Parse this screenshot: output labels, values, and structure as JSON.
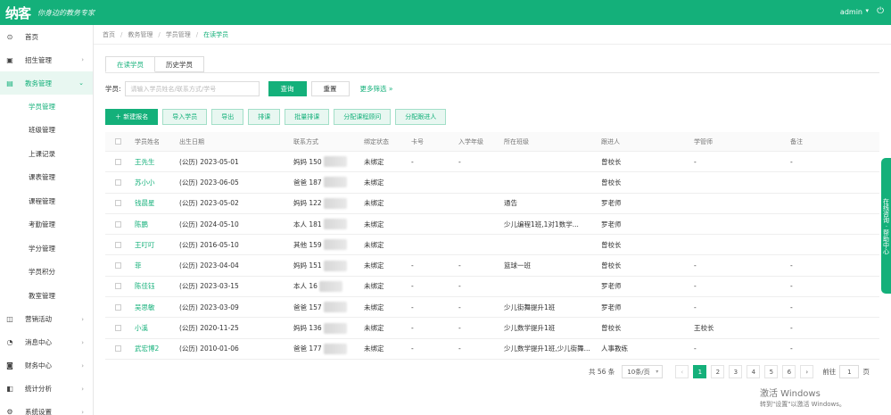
{
  "header": {
    "logo": "纳客",
    "slogan": "你身边的教务专家",
    "user": "admin"
  },
  "sidebar": {
    "items": [
      {
        "icon": "home-icon",
        "label": "首页",
        "arrow": ""
      },
      {
        "icon": "recruit-icon",
        "label": "招生管理",
        "arrow": "›"
      },
      {
        "icon": "book-icon",
        "label": "教务管理",
        "arrow": "⌄"
      }
    ],
    "sub_items": [
      "学员管理",
      "班级管理",
      "上课记录",
      "课表管理",
      "课程管理",
      "考勤管理",
      "学分管理",
      "学员积分",
      "教室管理"
    ],
    "bottom_items": [
      {
        "icon": "marketing-icon",
        "label": "营销活动",
        "arrow": "›"
      },
      {
        "icon": "message-icon",
        "label": "消息中心",
        "arrow": "›"
      },
      {
        "icon": "finance-icon",
        "label": "财务中心",
        "arrow": "›"
      },
      {
        "icon": "stats-icon",
        "label": "统计分析",
        "arrow": "›"
      },
      {
        "icon": "settings-icon",
        "label": "系统设置",
        "arrow": "›"
      }
    ]
  },
  "breadcrumb": {
    "home": "首页",
    "l1": "教务管理",
    "l2": "学员管理",
    "current": "在读学员"
  },
  "tabs": [
    "在读学员",
    "历史学员"
  ],
  "search": {
    "label": "学员:",
    "placeholder": "请输入学员姓名/联系方式/学号",
    "query_btn": "查询",
    "reset_btn": "重置",
    "more": "更多筛选 »"
  },
  "actions": [
    "＋ 新建报名",
    "导入学员",
    "导出",
    "排课",
    "批量排课",
    "分配课程顾问",
    "分配跟进人"
  ],
  "table": {
    "headers": [
      "学员姓名",
      "出生日期",
      "联系方式",
      "绑定状态",
      "卡号",
      "入学年级",
      "所在班级",
      "跟进人",
      "学管师",
      "备注"
    ],
    "rows": [
      [
        "王先生",
        "(公历) 2023-05-01",
        "妈妈 150",
        "未绑定",
        "-",
        "-",
        "",
        "曾校长",
        "-",
        "-"
      ],
      [
        "苏小小",
        "(公历) 2023-06-05",
        "爸爸 187",
        "未绑定",
        "",
        "",
        "",
        "曾校长",
        "",
        ""
      ],
      [
        "钱晨星",
        "(公历) 2023-05-02",
        "妈妈 122",
        "未绑定",
        "",
        "",
        "通告",
        "罗老师",
        "",
        ""
      ],
      [
        "陈鹏",
        "(公历) 2024-05-10",
        "本人 181",
        "未绑定",
        "",
        "",
        "少儿编程1班,1对1数学...",
        "罗老师",
        "",
        ""
      ],
      [
        "王叮叮",
        "(公历) 2016-05-10",
        "其他 159",
        "未绑定",
        "",
        "",
        "",
        "曾校长",
        "",
        ""
      ],
      [
        "菲",
        "(公历) 2023-04-04",
        "妈妈 151",
        "未绑定",
        "-",
        "-",
        "篮球一班",
        "曾校长",
        "-",
        "-"
      ],
      [
        "陈佳钰",
        "(公历) 2023-03-15",
        "本人 16",
        "未绑定",
        "-",
        "-",
        "",
        "罗老师",
        "-",
        "-"
      ],
      [
        "吴思敏",
        "(公历) 2023-03-09",
        "爸爸 157",
        "未绑定",
        "-",
        "-",
        "少儿街舞提升1班",
        "罗老师",
        "-",
        "-"
      ],
      [
        "小溪",
        "(公历) 2020-11-25",
        "妈妈 136",
        "未绑定",
        "-",
        "-",
        "少儿数学提升1班",
        "曾校长",
        "王校长",
        "-"
      ],
      [
        "武宏博2",
        "(公历) 2010-01-06",
        "爸爸 177",
        "未绑定",
        "-",
        "-",
        "少儿数学提升1班,少儿街舞...",
        "人事教练",
        "-",
        "-"
      ]
    ]
  },
  "pagination": {
    "total": "共 56 条",
    "page_size": "10条/页",
    "prev": "‹",
    "pages": [
      "1",
      "2",
      "3",
      "4",
      "5",
      "6"
    ],
    "next": "›",
    "goto": "前往",
    "goto_value": "1",
    "goto_suffix": "页"
  },
  "side_tab": "在线咨询 · 帮助中心",
  "watermark": {
    "line1": "激活 Windows",
    "line2": "转到\"设置\"以激活 Windows。"
  },
  "colors": {
    "primary": "#14b07a"
  }
}
